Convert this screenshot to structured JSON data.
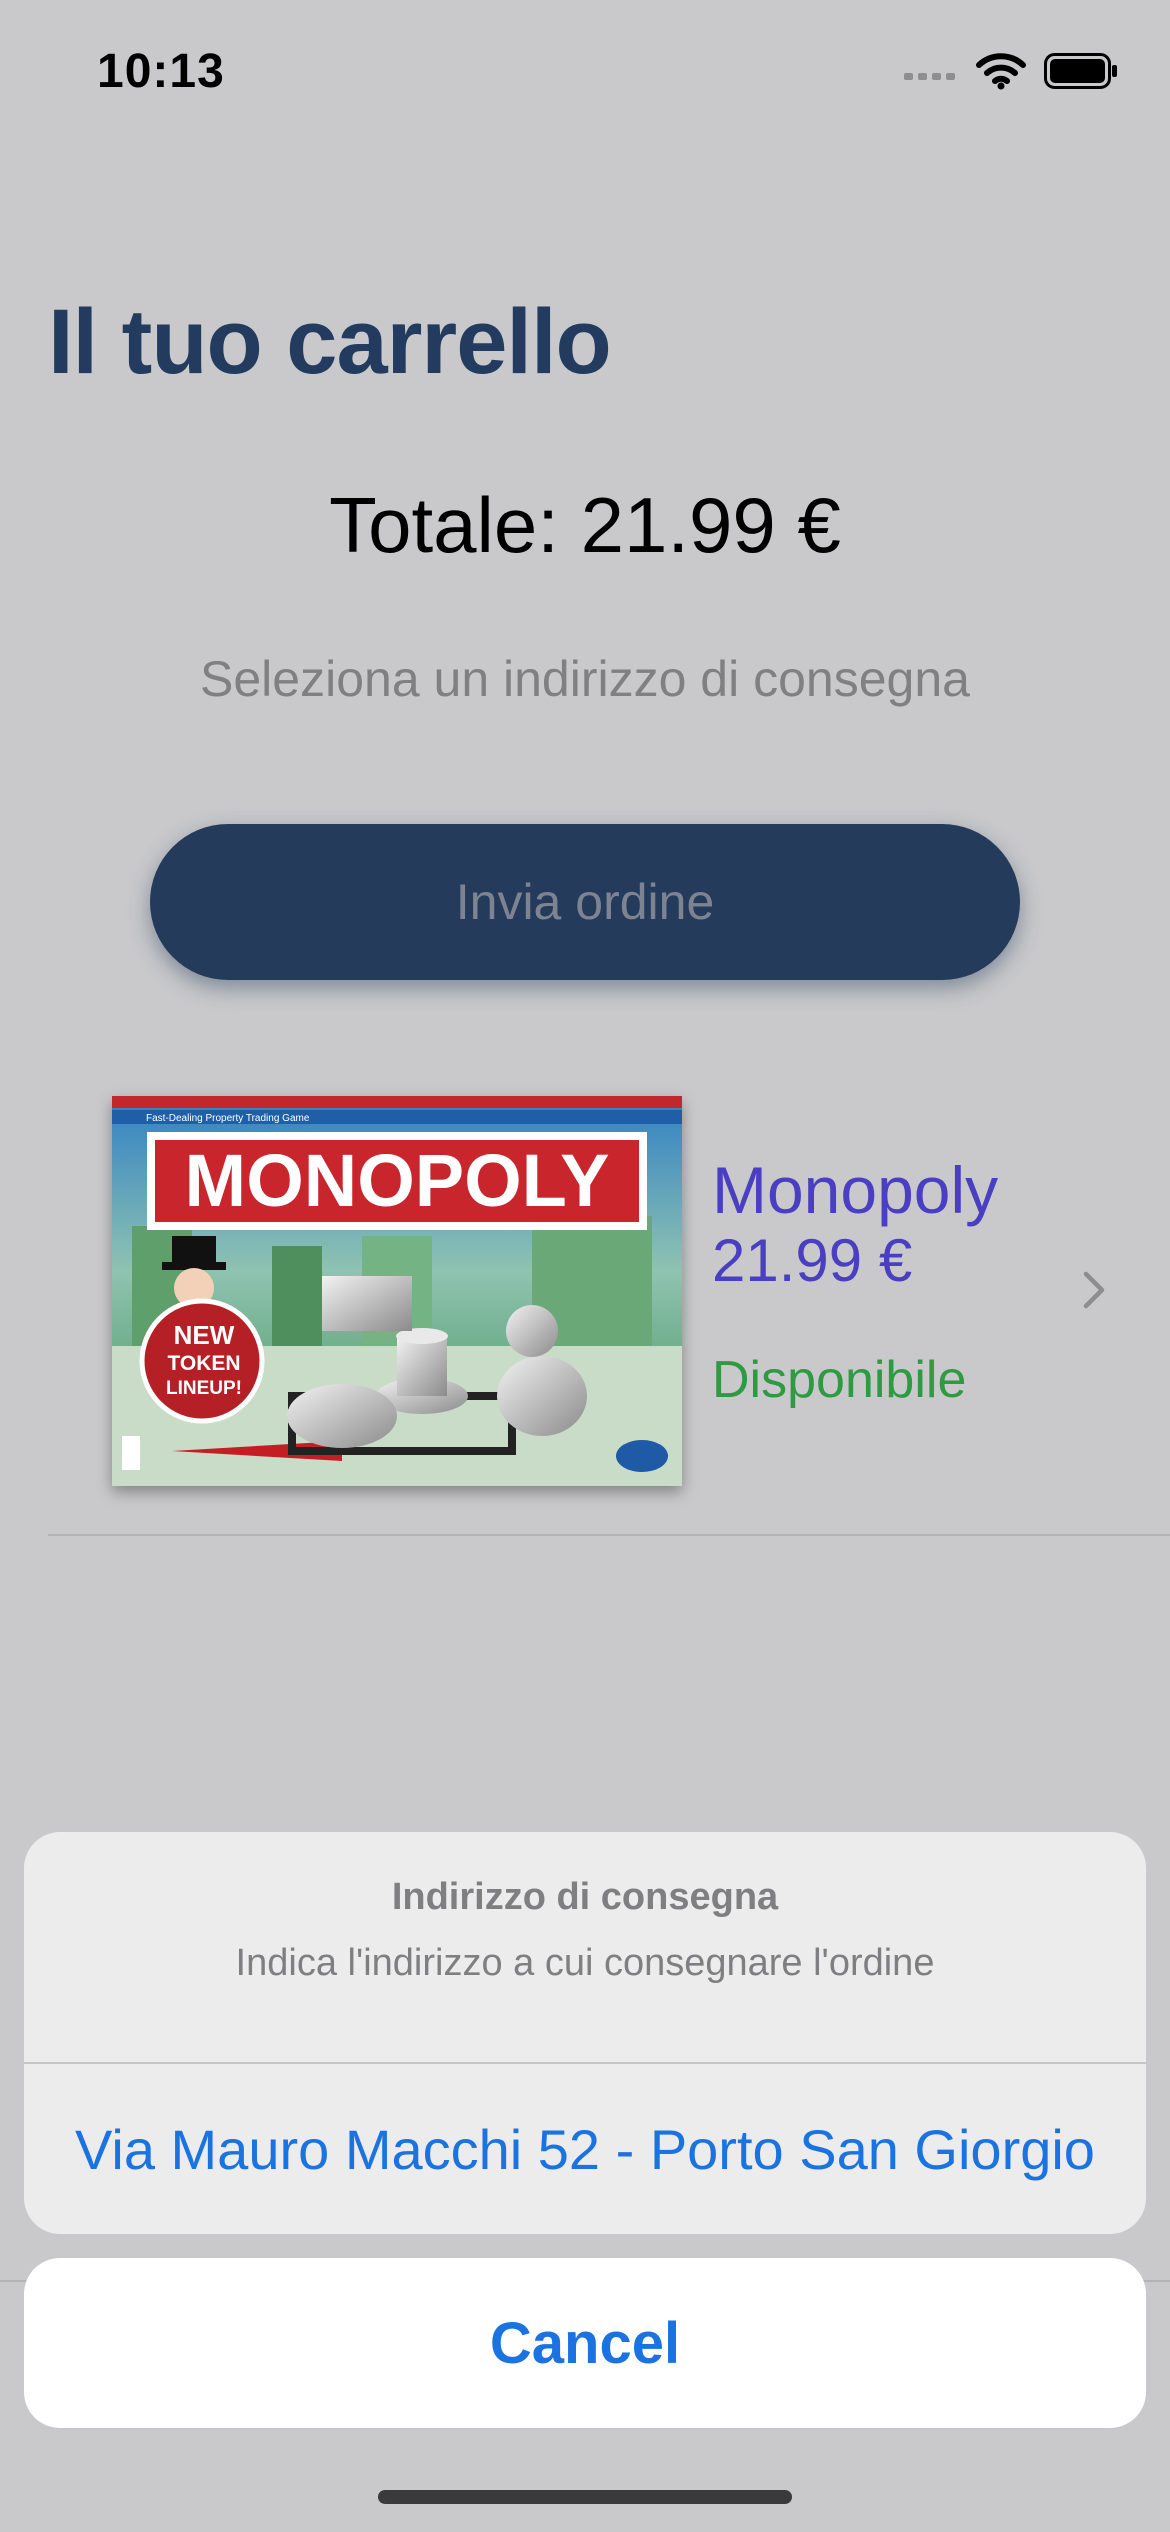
{
  "status_bar": {
    "time": "10:13",
    "icons": [
      "cellular-signal-icon",
      "wifi-icon",
      "battery-icon"
    ]
  },
  "header": {
    "title": "Il tuo carrello"
  },
  "summary": {
    "total": "Totale: 21.99 €",
    "address_hint": "Seleziona un indirizzo di consegna",
    "send_button_label": "Invia ordine"
  },
  "cart": {
    "items": [
      {
        "name": "Monopoly",
        "price": "21.99 €",
        "availability": "Disponibile",
        "box_title": "MONOPOLY",
        "box_badge": [
          "NEW",
          "TOKEN",
          "LINEUP!"
        ],
        "box_tagline": "Fast-Dealing Property Trading Game"
      }
    ]
  },
  "action_sheet": {
    "title": "Indirizzo di consegna",
    "message": "Indica l'indirizzo a cui consegnare l'ordine",
    "options": [
      "Via Mauro Macchi 52 - Porto San Giorgio"
    ],
    "cancel_label": "Cancel"
  },
  "colors": {
    "background": "#c9c9cb",
    "title": "#223b5e",
    "button": "#243b5c",
    "product_text": "#4a3fc3",
    "available": "#2e9a41",
    "action_blue": "#1a73e0"
  }
}
